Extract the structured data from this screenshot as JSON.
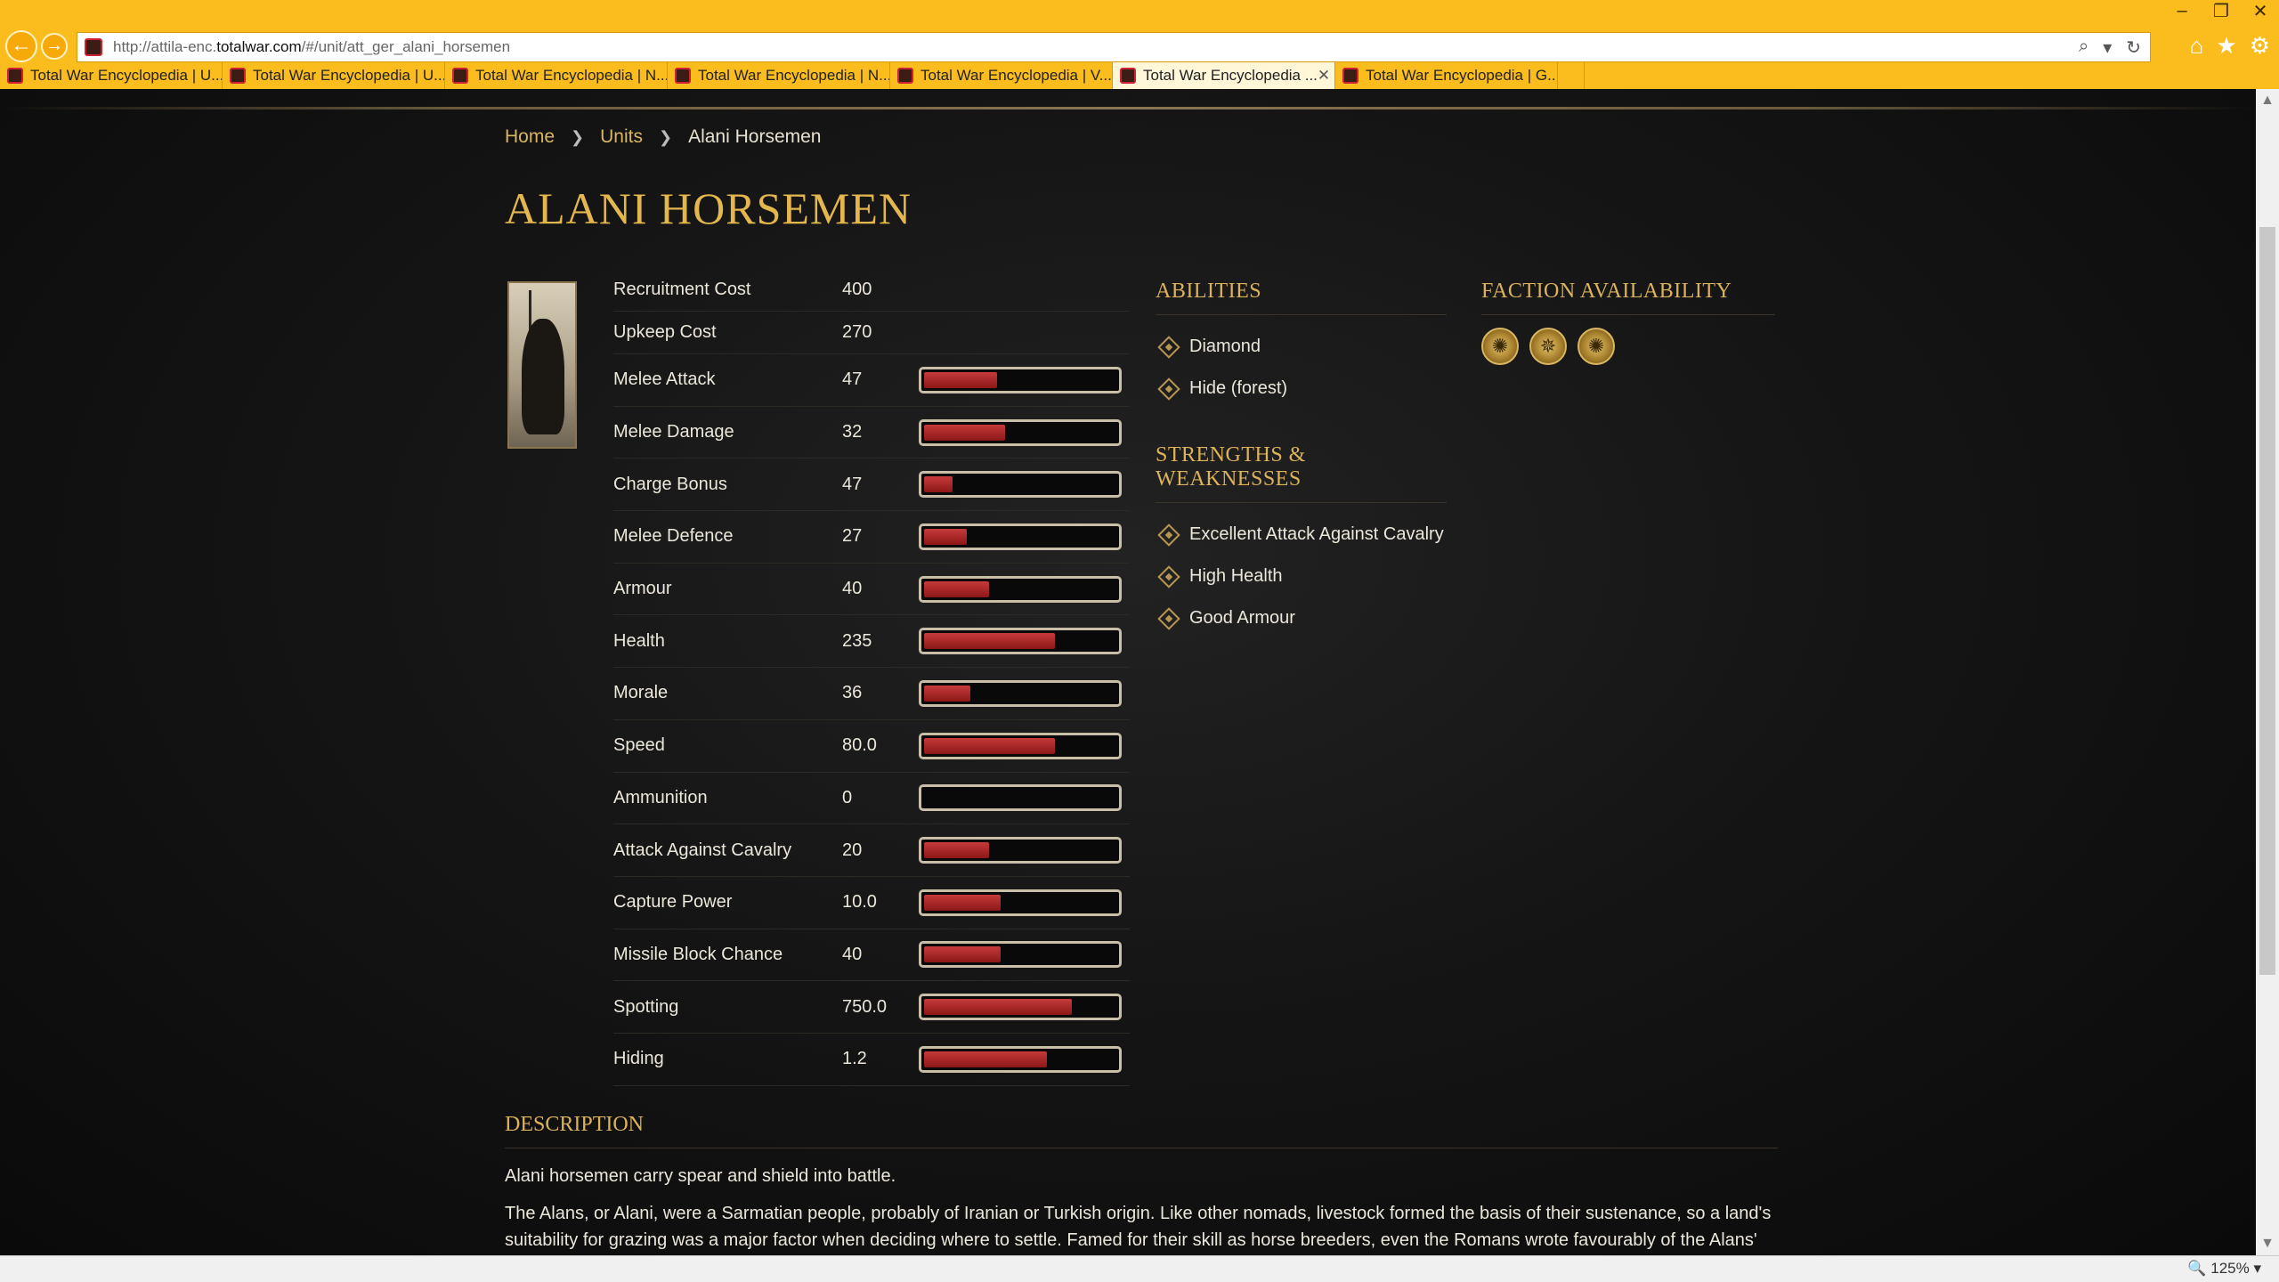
{
  "browser": {
    "url_prefix": "http://attila-enc.",
    "url_domain": "totalwar.com",
    "url_path": "/#/unit/att_ger_alani_horsemen",
    "tabs": [
      {
        "label": "Total War Encyclopedia | U...",
        "active": false
      },
      {
        "label": "Total War Encyclopedia | U...",
        "active": false
      },
      {
        "label": "Total War Encyclopedia | N...",
        "active": false
      },
      {
        "label": "Total War Encyclopedia | N...",
        "active": false
      },
      {
        "label": "Total War Encyclopedia | V...",
        "active": false
      },
      {
        "label": "Total War Encyclopedia ...",
        "active": true
      },
      {
        "label": "Total War Encyclopedia | G...",
        "active": false
      }
    ],
    "zoom": "125%"
  },
  "breadcrumb": {
    "home": "Home",
    "units": "Units",
    "current": "Alani Horsemen"
  },
  "unit": {
    "title": "ALANI HORSEMEN",
    "stats": [
      {
        "label": "Recruitment Cost",
        "value": "400"
      },
      {
        "label": "Upkeep Cost",
        "value": "270"
      },
      {
        "label": "Melee Attack",
        "value": "47",
        "bar": 0.38
      },
      {
        "label": "Melee Damage",
        "value": "32",
        "bar": 0.42
      },
      {
        "label": "Charge Bonus",
        "value": "47",
        "bar": 0.15
      },
      {
        "label": "Melee Defence",
        "value": "27",
        "bar": 0.22
      },
      {
        "label": "Armour",
        "value": "40",
        "bar": 0.34
      },
      {
        "label": "Health",
        "value": "235",
        "bar": 0.68
      },
      {
        "label": "Morale",
        "value": "36",
        "bar": 0.24
      },
      {
        "label": "Speed",
        "value": "80.0",
        "bar": 0.68
      },
      {
        "label": "Ammunition",
        "value": "0",
        "bar": 0
      },
      {
        "label": "Attack Against Cavalry",
        "value": "20",
        "bar": 0.34
      },
      {
        "label": "Capture Power",
        "value": "10.0",
        "bar": 0.4
      },
      {
        "label": "Missile Block Chance",
        "value": "40",
        "bar": 0.4
      },
      {
        "label": "Spotting",
        "value": "750.0",
        "bar": 0.77
      },
      {
        "label": "Hiding",
        "value": "1.2",
        "bar": 0.64
      }
    ]
  },
  "abilities": {
    "title": "ABILITIES",
    "items": [
      "Diamond",
      "Hide (forest)"
    ]
  },
  "strengths": {
    "title": "STRENGTHS & WEAKNESSES",
    "items": [
      "Excellent Attack Against Cavalry",
      "High Health",
      "Good Armour"
    ]
  },
  "factions": {
    "title": "FACTION AVAILABILITY"
  },
  "description": {
    "title": "DESCRIPTION",
    "p1": "Alani horsemen carry spear and shield into battle.",
    "p2_line1": "The Alans, or Alani, were a Sarmatian people, probably of Iranian or Turkish origin. Like other nomads, livestock formed the basis of their sustenance, so a land's",
    "p2_line2": "suitability for grazing was a major factor when deciding where to settle. Famed for their skill as horse breeders, even the Romans wrote favourably of the Alans'"
  }
}
